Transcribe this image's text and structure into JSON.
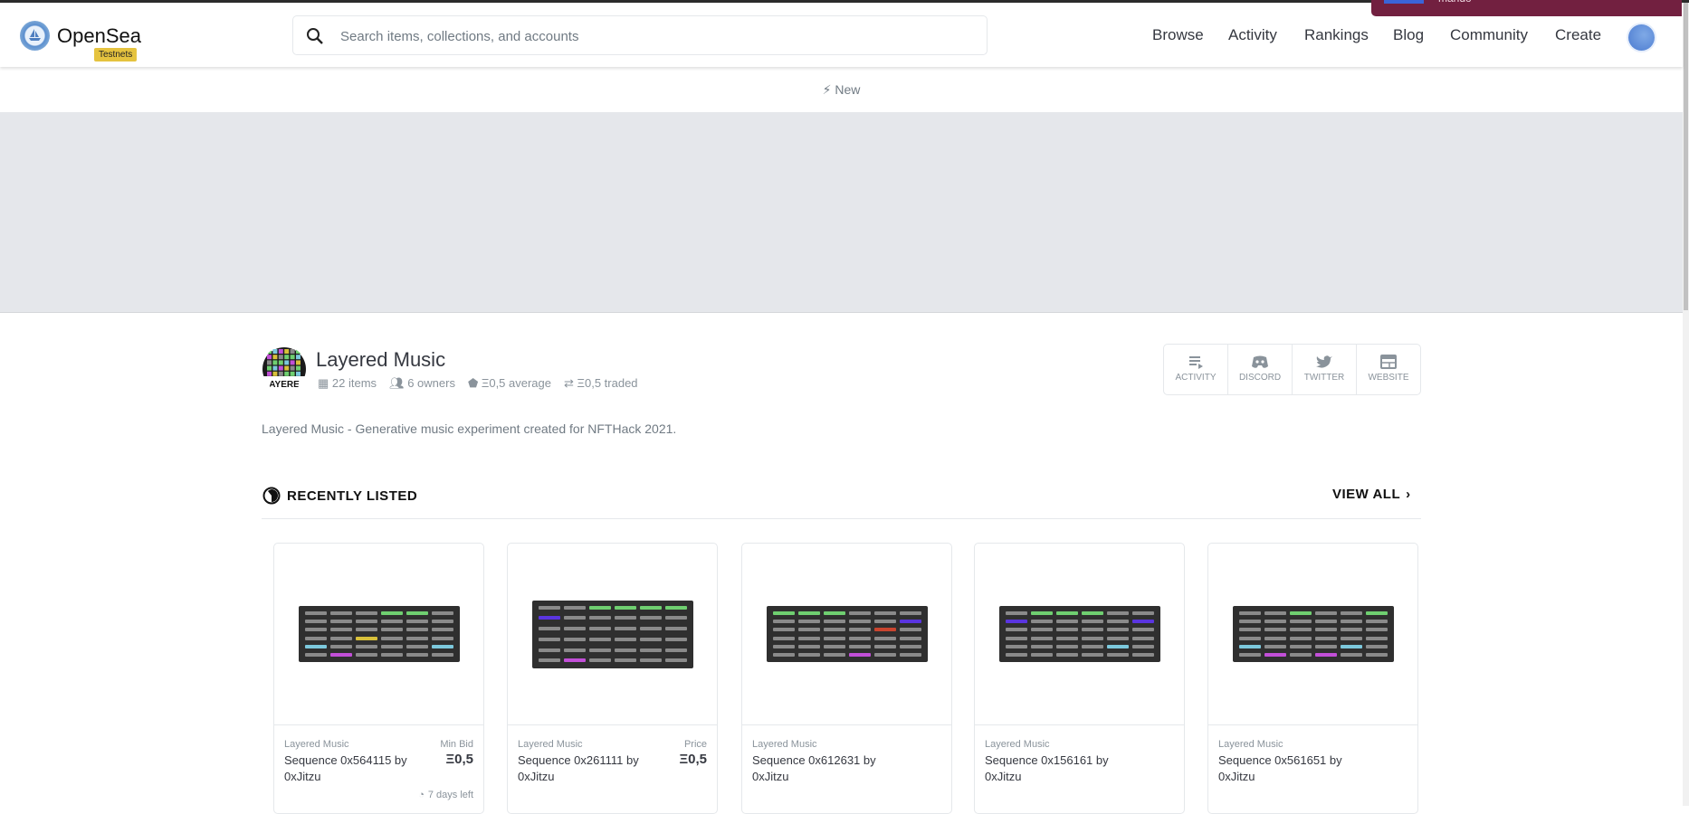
{
  "header": {
    "brand": "OpenSea",
    "badge": "Testnets",
    "search_placeholder": "Search items, collections, and accounts",
    "nav": [
      "Browse",
      "Activity",
      "Rankings",
      "Blog",
      "Community",
      "Create"
    ]
  },
  "notification": {
    "text": "mando"
  },
  "new_bar": {
    "label": "New"
  },
  "collection": {
    "title": "Layered Music",
    "avatar_text": "AYERE",
    "stats": {
      "items": "22 items",
      "owners": "6 owners",
      "average": "Ξ0,5 average",
      "traded": "Ξ0,5 traded"
    },
    "social": [
      "ACTIVITY",
      "DISCORD",
      "TWITTER",
      "WEBSITE"
    ],
    "description": "Layered Music - Generative music experiment created for NFTHack 2021."
  },
  "section": {
    "title": "RECENTLY LISTED",
    "view_all": "VIEW ALL"
  },
  "colors": {
    "g": "#6fcf70",
    "b": "#5a35e0",
    "y": "#d8c03a",
    "c": "#7cc8dc",
    "m": "#c24fd8",
    "r": "#c9452f",
    "grey": "#8a8a8a",
    "toast": "#722040",
    "badge": "#e5c33f"
  },
  "cards": [
    {
      "collection": "Layered Music",
      "name": "Sequence 0x564115 by 0xJitzu",
      "price_label": "Min Bid",
      "price": "Ξ0,5",
      "time_left": "7 days left",
      "grid": [
        "...gg.",
        "......",
        "......",
        "..y...",
        "c....c",
        ".m...."
      ]
    },
    {
      "collection": "Layered Music",
      "name": "Sequence 0x261111 by 0xJitzu",
      "price_label": "Price",
      "price": "Ξ0,5",
      "grid": [
        "..gggg",
        "b.....",
        "......",
        "......",
        "......",
        ".m...."
      ]
    },
    {
      "collection": "Layered Music",
      "name": "Sequence 0x612631 by 0xJitzu",
      "grid": [
        "ggg...",
        ".....b",
        "....r.",
        "......",
        "......",
        "...m.."
      ]
    },
    {
      "collection": "Layered Music",
      "name": "Sequence 0x156161 by 0xJitzu",
      "grid": [
        ".ggg..",
        "b....b",
        "......",
        "......",
        "....c.",
        "......"
      ]
    },
    {
      "collection": "Layered Music",
      "name": "Sequence 0x561651 by 0xJitzu",
      "grid": [
        "..g..g",
        "......",
        "......",
        "......",
        "c...c.",
        ".m.m.."
      ]
    }
  ]
}
